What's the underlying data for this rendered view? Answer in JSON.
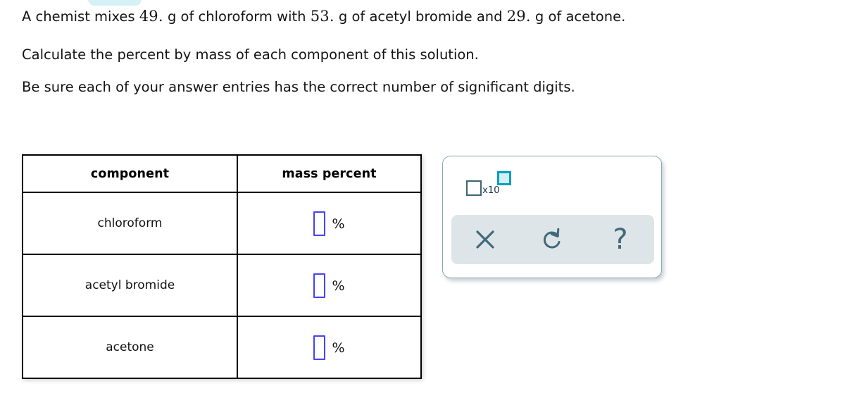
{
  "problem": {
    "line1_prefix": "A chemist mixes ",
    "mass_chloroform": "49.",
    "line1_mid1": " g of chloroform with ",
    "mass_acetyl_bromide": "53.",
    "line1_mid2": " g of acetyl bromide and ",
    "mass_acetone": "29.",
    "line1_suffix": " g of acetone.",
    "line2": "Calculate the percent by mass of each component of this solution.",
    "line3": "Be sure each of your answer entries has the correct number of significant digits."
  },
  "table": {
    "headers": [
      "component",
      "mass percent"
    ],
    "rows": [
      {
        "component": "chloroform",
        "value": "",
        "unit": "%"
      },
      {
        "component": "acetyl bromide",
        "value": "",
        "unit": "%"
      },
      {
        "component": "acetone",
        "value": "",
        "unit": "%"
      }
    ]
  },
  "tool_panel": {
    "scientific_notation": {
      "icon_name": "scientific-notation-icon",
      "label": "x10"
    },
    "actions": [
      {
        "name": "clear-button",
        "icon": "x-icon"
      },
      {
        "name": "undo-button",
        "icon": "undo-arrow-icon"
      },
      {
        "name": "help-button",
        "icon": "question-mark-icon",
        "glyph": "?"
      }
    ]
  },
  "colors": {
    "input_border": "#4444f5",
    "exponent_accent": "#00a0c0",
    "exponent_fill": "#d2eff5",
    "panel_border": "#8ba6b3",
    "action_bar_bg": "#dde5e8",
    "icon_color": "#41697a",
    "top_pill": "#d4f1f5"
  }
}
